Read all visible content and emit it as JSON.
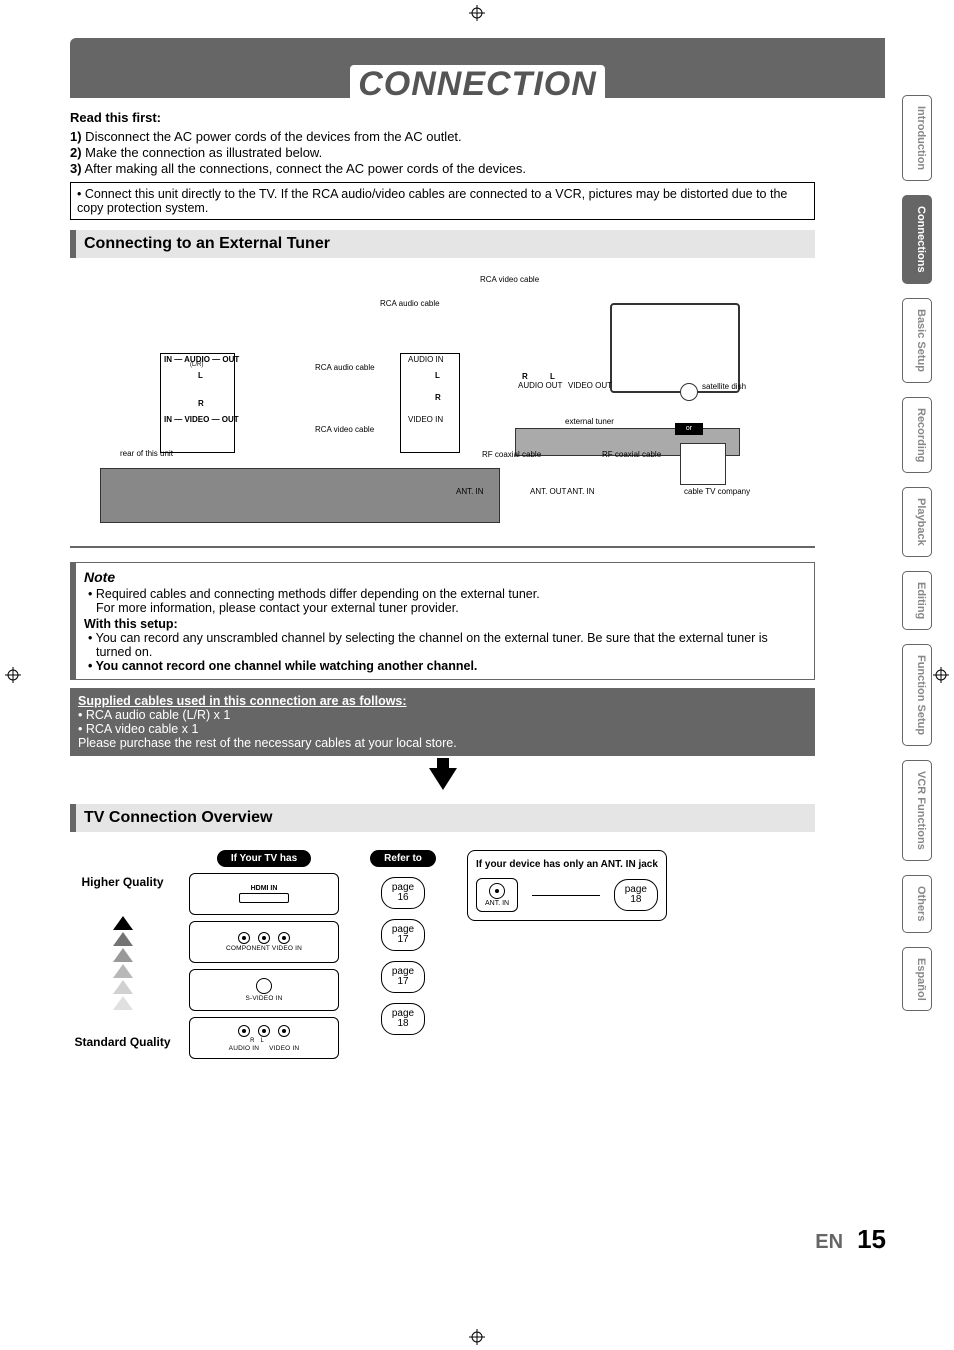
{
  "title": "CONNECTION",
  "read_first_heading": "Read this first:",
  "steps": {
    "s1_num": "1)",
    "s1": " Disconnect the AC power cords of the devices from the AC outlet.",
    "s2_num": "2)",
    "s2": " Make the connection as illustrated below.",
    "s3_num": "3)",
    "s3": " After making all the connections, connect the AC power cords of the devices."
  },
  "warning": "Connect this unit directly to the TV. If the RCA audio/video cables are connected to a VCR, pictures may be distorted due to the copy protection system.",
  "section1": "Connecting to an External Tuner",
  "diagram": {
    "rca_video_cable": "RCA video cable",
    "rca_audio_cable": "RCA audio  cable",
    "audio_in": "AUDIO IN",
    "video_in": "VIDEO IN",
    "l": "L",
    "r": "R",
    "in_audio_out": "IN — AUDIO — OUT",
    "in_video_out": "IN — VIDEO — OUT",
    "lr_small": "(L/R)",
    "rear": "rear of this unit",
    "rf_coaxial": "RF coaxial cable",
    "ant_in": "ANT. IN",
    "ant_out": "ANT. OUT",
    "audio_out": "AUDIO OUT",
    "video_out": "VIDEO OUT",
    "external_tuner": "external tuner",
    "sat_dish": "satellite dish",
    "or": "or",
    "cable_tv": "cable TV company"
  },
  "note": {
    "title": "Note",
    "line1": "Required cables and connecting methods differ depending on the external tuner.",
    "line1b": "For more information, please contact your external tuner provider.",
    "with_setup": "With this setup:",
    "line2": "You can record any unscrambled channel by selecting the channel on the external tuner. Be sure that the external tuner is turned on.",
    "line3": "You cannot record one channel while watching another channel."
  },
  "supplied": {
    "heading": "Supplied cables used in this connection are as follows:",
    "line1": "• RCA audio cable (L/R) x 1",
    "line2": "• RCA video cable x 1",
    "line3": "Please purchase the rest of the necessary cables at your local store."
  },
  "section2": "TV Connection Overview",
  "overview": {
    "higher_quality": "Higher Quality",
    "standard_quality": "Standard Quality",
    "if_tv_has": "If Your TV has",
    "refer_to": "Refer to",
    "hdmi_in": "HDMI IN",
    "component": "COMPONENT VIDEO IN",
    "svideo": "S-VIDEO IN",
    "av_r": "R",
    "av_l": "L",
    "audio_in": "AUDIO IN",
    "video_in": "VIDEO IN",
    "page": "page",
    "p16": "16",
    "p17": "17",
    "p18": "18",
    "ant_note": "If your device has only an ANT. IN jack",
    "ant_in": "ANT. IN"
  },
  "tabs": {
    "t1": "Introduction",
    "t2": "Connections",
    "t3": "Basic Setup",
    "t4": "Recording",
    "t5": "Playback",
    "t6": "Editing",
    "t7": "Function Setup",
    "t8": "VCR Functions",
    "t9": "Others",
    "t10": "Español"
  },
  "footer": {
    "lang": "EN",
    "num": "15"
  }
}
